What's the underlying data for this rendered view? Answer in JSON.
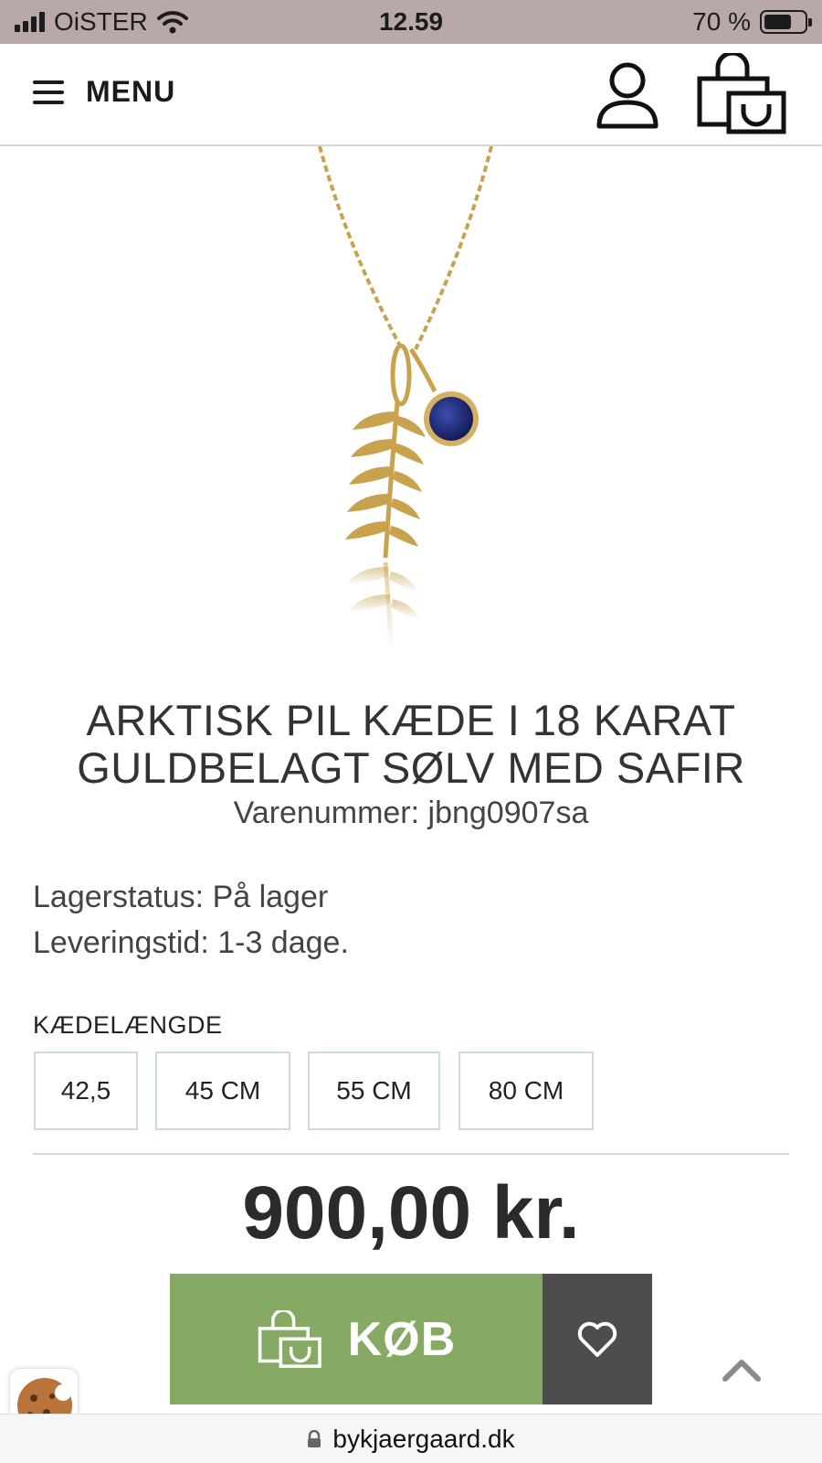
{
  "status_bar": {
    "carrier": "OiSTER",
    "time": "12.59",
    "battery_text": "70 %",
    "battery_level": 0.7
  },
  "header": {
    "menu_label": "MENU",
    "icons": [
      "hamburger-icon",
      "user-icon",
      "shopping-bag-icon"
    ]
  },
  "product": {
    "image_icon": "necklace-leaf-sapphire-image",
    "title_line1": "ARKTISK PIL KÆDE I 18 KARAT",
    "title_line2": "GULDBELAGT SØLV MED SAFIR",
    "sku": "Varenummer: jbng0907sa",
    "stock": "Lagerstatus: På lager",
    "delivery": "Leveringstid: 1-3 dage.",
    "chain_length_label": "KÆDELÆNGDE",
    "chain_lengths": [
      "42,5",
      "45 CM",
      "55 CM",
      "80 CM"
    ],
    "price": "900,00 kr."
  },
  "actions": {
    "buy_label": "KØB",
    "icons": [
      "shopping-bag-icon",
      "heart-icon",
      "chevron-up-icon",
      "cookie-icon",
      "lock-icon"
    ]
  },
  "browser": {
    "url": "bykjaergaard.dk"
  },
  "colors": {
    "status_bar": "#b8a9a8",
    "buy_button": "#86aa64",
    "wishlist_button": "#4d4d4d",
    "size_border": "#c8dbe3",
    "gold": "#c9a24e",
    "sapphire": "#1f2a78"
  }
}
